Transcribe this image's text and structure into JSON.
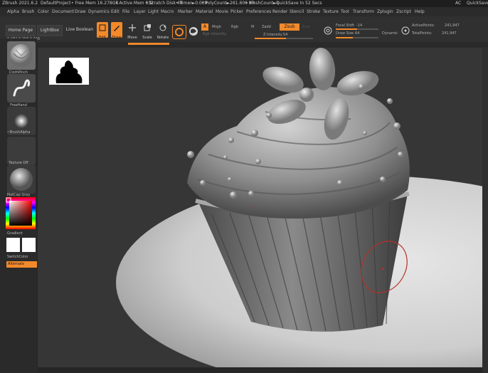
{
  "titlebar": {
    "app": "ZBrush 2021.6.2",
    "project": "DefaultProject",
    "free_mem": "• Free Mem 16.278GB",
    "active_mem": "• Active Mem 932",
    "scratch_disk": "• Scratch Disk 49",
    "timer": "• Timer►0.009",
    "polycount": "• PolyCount►261.606 KP",
    "meshcount": "• MeshCount►1",
    "quicksave": "QuickSave In 52 Secs",
    "ac": "AC",
    "quicksave_btn": "QuickSave"
  },
  "menu": [
    "Alpha",
    "Brush",
    "Color",
    "Document",
    "Draw",
    "Dynamics",
    "Edit",
    "File",
    "Layer",
    "Light",
    "Macro",
    "Marker",
    "Material",
    "Movie",
    "Picker",
    "Preferences",
    "Render",
    "Stencil",
    "Stroke",
    "Texture",
    "Tool",
    "Transform",
    "Zplugin",
    "Zscript",
    "Help"
  ],
  "toolbar": {
    "home_page": "Home Page",
    "lightbox": "LightBox",
    "live_boolean": "Live Boolean",
    "edit": "Edit",
    "draw": "Draw",
    "move": "Move",
    "scale": "Scale",
    "rotate": "Rotate",
    "a": "A",
    "mrgb": "Mrgb",
    "rgb": "Rgb",
    "m": "M",
    "zadd": "Zadd",
    "zsub": "Zsub",
    "zcut": "Zcut",
    "rgb_intensity": "Rgb Intensity",
    "z_intensity_label": "Z Intensity",
    "z_intensity_value": "54",
    "focal_shift_label": "Focal Shift",
    "focal_shift_value": "-14",
    "draw_size_label": "Draw Size",
    "draw_size_value": "64",
    "dynamic": "Dynamic",
    "active_points_label": "ActivePoints:",
    "active_points_value": "241,947",
    "total_points_label": "TotalPoints:",
    "total_points_value": "241,947",
    "coords": "0.482,0.258,0.046"
  },
  "leftpanel": {
    "brush": "ClothPinch",
    "stroke": "FreeHand",
    "alpha": "~BrushAlpha",
    "texture": "Texture Off",
    "material": "MatCap Gray",
    "gradient": "Gradient",
    "switch_color": "SwitchColor",
    "alternate": "Alternate"
  },
  "colors": {
    "accent": "#f2892b",
    "background": "#363636"
  }
}
